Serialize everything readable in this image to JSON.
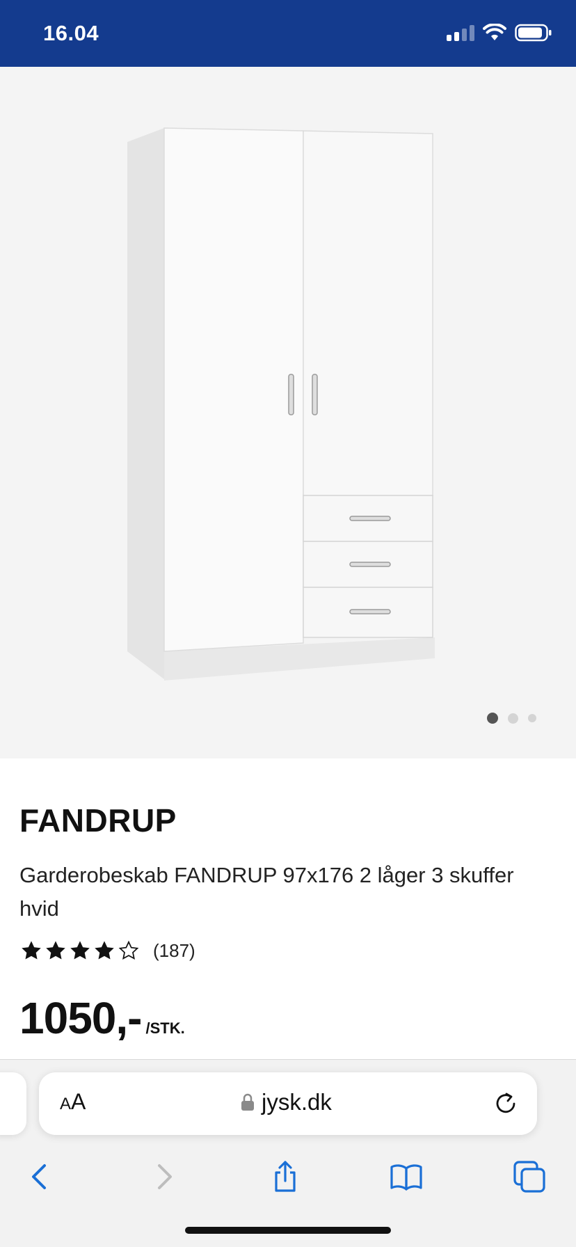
{
  "status_bar": {
    "time": "16.04",
    "signal_icon": "cellular-signal-icon",
    "wifi_icon": "wifi-icon",
    "battery_icon": "battery-icon",
    "background_color": "#143b8e"
  },
  "gallery": {
    "image_icon": "wardrobe-product-image",
    "slide_count": 3,
    "active_slide": 1
  },
  "product": {
    "brand": "FANDRUP",
    "description": "Garderobeskab FANDRUP 97x176 2 låger 3 skuffer hvid",
    "rating": 4,
    "rating_max": 5,
    "review_count": "(187)",
    "price": "1050,-",
    "price_unit": "/STK."
  },
  "browser": {
    "aa_large": "A",
    "aa_small": "A",
    "url": "jysk.dk",
    "lock_icon": "lock-icon",
    "reload_icon": "reload-icon",
    "toolbar": {
      "back_icon": "chevron-left-icon",
      "forward_icon": "chevron-right-icon",
      "share_icon": "share-icon",
      "bookmarks_icon": "book-icon",
      "tabs_icon": "tabs-icon"
    },
    "accent_color": "#1a6fd6"
  }
}
